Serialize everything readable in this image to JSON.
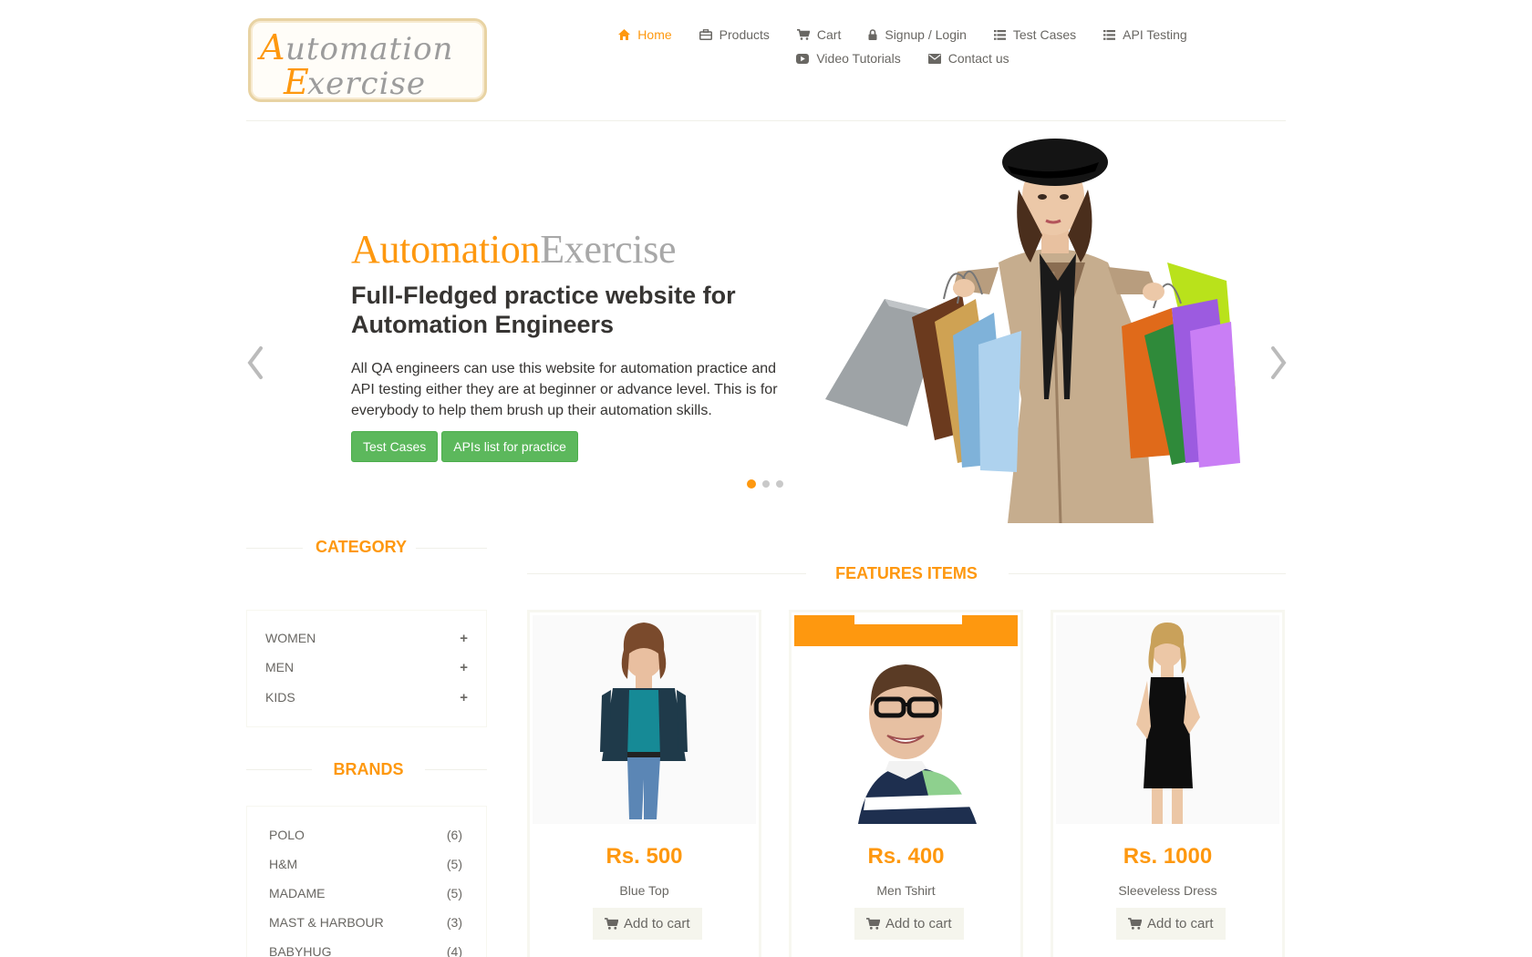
{
  "logo": {
    "line1": "Automation",
    "line2": "Exercise"
  },
  "nav": [
    {
      "label": "Home",
      "icon": "home-icon",
      "active": true
    },
    {
      "label": "Products",
      "icon": "briefcase-icon"
    },
    {
      "label": "Cart",
      "icon": "cart-icon"
    },
    {
      "label": "Signup / Login",
      "icon": "lock-icon"
    },
    {
      "label": "Test Cases",
      "icon": "list-icon"
    },
    {
      "label": "API Testing",
      "icon": "list-icon"
    },
    {
      "label": "Video Tutorials",
      "icon": "youtube-play-icon"
    },
    {
      "label": "Contact us",
      "icon": "envelope-icon"
    }
  ],
  "slider": {
    "brand_a": "Automation",
    "brand_b": "Exercise",
    "heading": "Full-Fledged practice website for Automation Engineers",
    "text": "All QA engineers can use this website for automation practice and API testing either they are at beginner or advance level. This is for everybody to help them brush up their automation skills.",
    "btn_test_cases": "Test Cases",
    "btn_apis": "APIs list for practice",
    "slide_count": 3,
    "active_slide": 1
  },
  "sidebar": {
    "category_title": "Category",
    "categories": [
      {
        "label": "Women"
      },
      {
        "label": "Men"
      },
      {
        "label": "Kids"
      }
    ],
    "brands_title": "Brands",
    "brands": [
      {
        "name": "POLO",
        "count": "(6)"
      },
      {
        "name": "H&M",
        "count": "(5)"
      },
      {
        "name": "MADAME",
        "count": "(5)"
      },
      {
        "name": "MAST & HARBOUR",
        "count": "(3)"
      },
      {
        "name": "BABYHUG",
        "count": "(4)"
      }
    ]
  },
  "features": {
    "title": "Features Items",
    "cart_label": "Add to cart",
    "products": [
      {
        "price": "Rs. 500",
        "name": "Blue Top"
      },
      {
        "price": "Rs. 400",
        "name": "Men Tshirt"
      },
      {
        "price": "Rs. 1000",
        "name": "Sleeveless Dress"
      }
    ]
  },
  "colors": {
    "accent": "#FE980F",
    "green": "#5cb85c",
    "text": "#696763",
    "dark": "#363432"
  }
}
